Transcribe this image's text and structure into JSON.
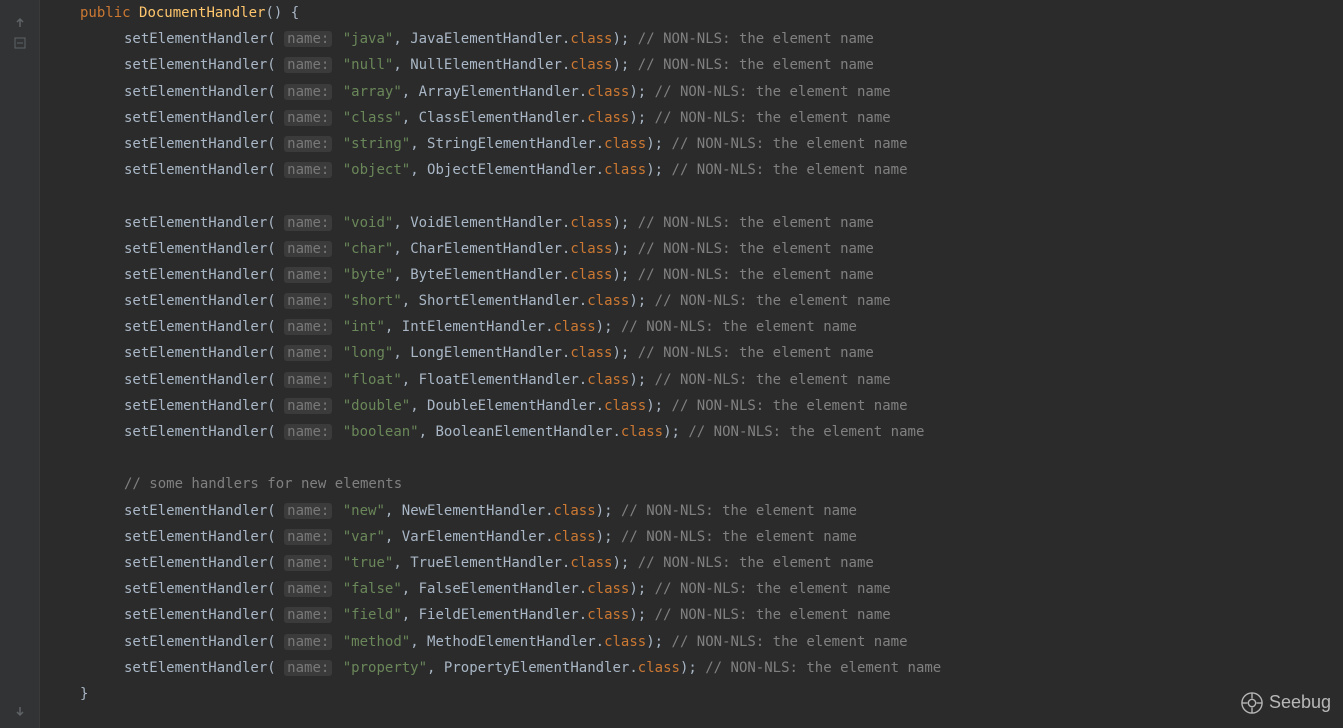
{
  "method_signature": {
    "modifier": "public",
    "name": "DocumentHandler",
    "open": "() {"
  },
  "hint_label": "name:",
  "call": "setElementHandler",
  "class_suffix": "class",
  "comment_text": "// NON-NLS: the element name",
  "comment_new_handlers": "// some handlers for new elements",
  "closing_brace": "}",
  "watermark": "Seebug",
  "handlers": [
    {
      "name": "\"java\"",
      "cls": "JavaElementHandler"
    },
    {
      "name": "\"null\"",
      "cls": "NullElementHandler"
    },
    {
      "name": "\"array\"",
      "cls": "ArrayElementHandler"
    },
    {
      "name": "\"class\"",
      "cls": "ClassElementHandler"
    },
    {
      "name": "\"string\"",
      "cls": "StringElementHandler"
    },
    {
      "name": "\"object\"",
      "cls": "ObjectElementHandler"
    }
  ],
  "handlers2": [
    {
      "name": "\"void\"",
      "cls": "VoidElementHandler"
    },
    {
      "name": "\"char\"",
      "cls": "CharElementHandler"
    },
    {
      "name": "\"byte\"",
      "cls": "ByteElementHandler"
    },
    {
      "name": "\"short\"",
      "cls": "ShortElementHandler"
    },
    {
      "name": "\"int\"",
      "cls": "IntElementHandler"
    },
    {
      "name": "\"long\"",
      "cls": "LongElementHandler"
    },
    {
      "name": "\"float\"",
      "cls": "FloatElementHandler"
    },
    {
      "name": "\"double\"",
      "cls": "DoubleElementHandler"
    },
    {
      "name": "\"boolean\"",
      "cls": "BooleanElementHandler"
    }
  ],
  "handlers3": [
    {
      "name": "\"new\"",
      "cls": "NewElementHandler"
    },
    {
      "name": "\"var\"",
      "cls": "VarElementHandler"
    },
    {
      "name": "\"true\"",
      "cls": "TrueElementHandler"
    },
    {
      "name": "\"false\"",
      "cls": "FalseElementHandler"
    },
    {
      "name": "\"field\"",
      "cls": "FieldElementHandler"
    },
    {
      "name": "\"method\"",
      "cls": "MethodElementHandler"
    },
    {
      "name": "\"property\"",
      "cls": "PropertyElementHandler"
    }
  ]
}
